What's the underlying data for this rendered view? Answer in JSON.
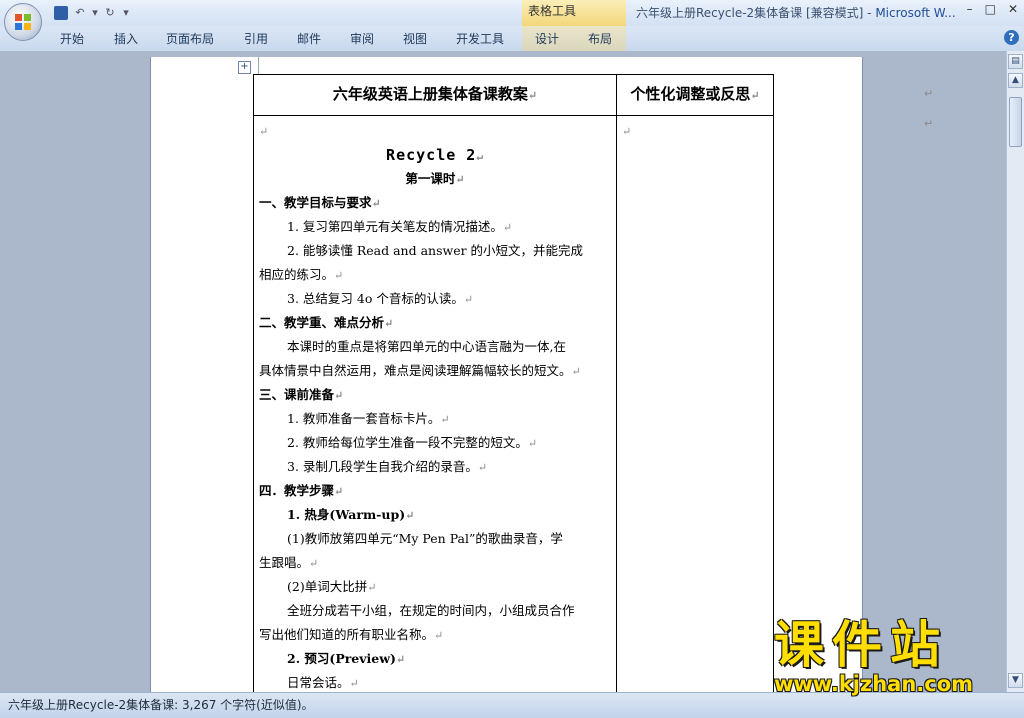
{
  "window": {
    "context_tools_label": "表格工具",
    "title_doc": "六年级上册Recycle-2集体备课 [兼容模式] - ",
    "title_app": "Microsoft W..."
  },
  "ribbon": {
    "tabs": [
      "开始",
      "插入",
      "页面布局",
      "引用",
      "邮件",
      "审阅",
      "视图",
      "开发工具",
      "设计",
      "布局"
    ]
  },
  "document": {
    "header_left": "六年级英语上册集体备课教案",
    "header_right": "个性化调整或反思",
    "pilcrow": "↵",
    "lines": [
      {
        "text": "",
        "style": ""
      },
      {
        "text": "Recycle 2",
        "style": "big c"
      },
      {
        "text": "第一课时",
        "style": "b c"
      },
      {
        "text": "一、教学目标与要求",
        "style": "b"
      },
      {
        "text": "1. 复习第四单元有关笔友的情况描述。",
        "style": "ind"
      },
      {
        "text": "2. 能够读懂 Read  and  answer 的小短文，并能完成",
        "style": "ind",
        "nomark": true
      },
      {
        "text": "相应的练习。",
        "style": ""
      },
      {
        "text": "3. 总结复习 4o 个音标的认读。",
        "style": "ind"
      },
      {
        "text": "二、教学重、难点分析",
        "style": "b"
      },
      {
        "text": "本课时的重点是将第四单元的中心语言融为一体,在",
        "style": "ind",
        "nomark": true
      },
      {
        "text": "具体情景中自然运用，难点是阅读理解篇幅较长的短文。",
        "style": ""
      },
      {
        "text": "三、课前准备",
        "style": "b"
      },
      {
        "text": "1. 教师准备一套音标卡片。",
        "style": "ind"
      },
      {
        "text": "2. 教师给每位学生准备一段不完整的短文。",
        "style": "ind"
      },
      {
        "text": "3. 录制几段学生自我介绍的录音。",
        "style": "ind"
      },
      {
        "text": "四．教学步骤",
        "style": "b"
      },
      {
        "text": "1. 热身(Warm-up)",
        "style": "b ind"
      },
      {
        "text": "(1)教师放第四单元“My Pen Pal”的歌曲录音，学",
        "style": "ind",
        "nomark": true
      },
      {
        "text": "生跟唱。",
        "style": ""
      },
      {
        "text": "(2)单词大比拼",
        "style": "ind"
      },
      {
        "text": "全班分成若干小组，在规定的时间内，小组成员合作",
        "style": "ind",
        "nomark": true
      },
      {
        "text": "写出他们知道的所有职业名称。",
        "style": ""
      },
      {
        "text": "2. 预习(Preview)",
        "style": "b ind"
      },
      {
        "text": "日常会话。",
        "style": "ind"
      }
    ]
  },
  "statusbar": {
    "text": "六年级上册Recycle-2集体备课: 3,267 个字符(近似值)。"
  },
  "watermark": {
    "cn": "课件站",
    "url": "www.kjzhan.com"
  }
}
